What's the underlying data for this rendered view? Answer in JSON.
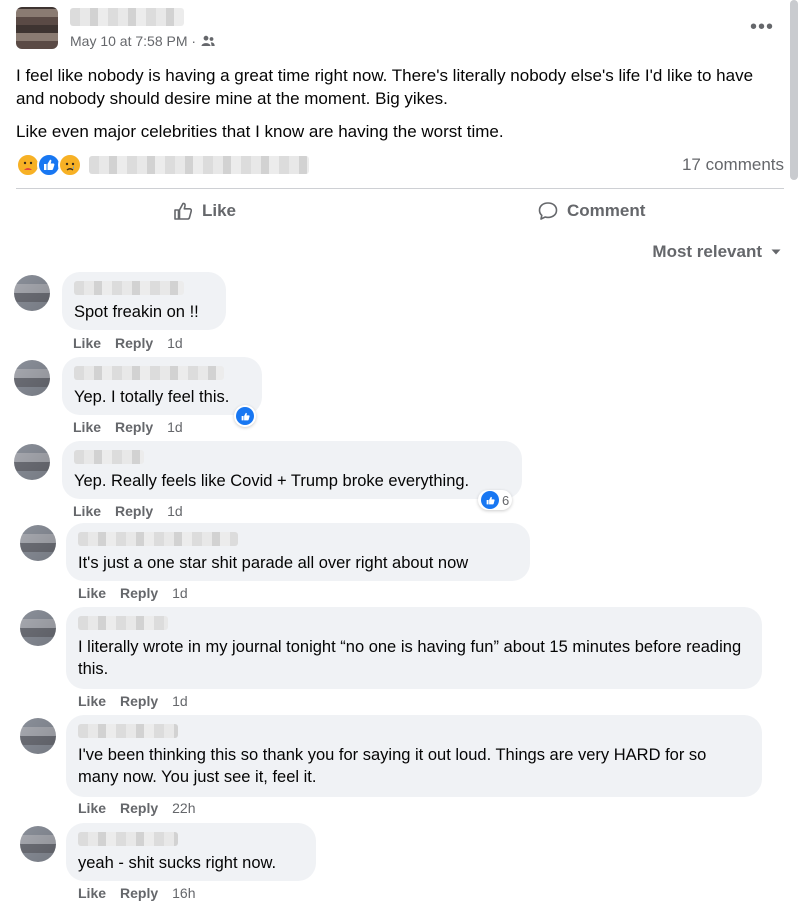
{
  "post": {
    "timestamp": "May 10 at 7:58 PM ·",
    "paragraphs": [
      "I feel like nobody is having a great time right now. There's literally nobody else's life I'd like to have and nobody should desire mine at the moment. Big yikes.",
      "Like even major celebrities that I know are having the worst time."
    ],
    "comments_count": "17 comments",
    "reaction_icons": [
      "care-reaction-icon",
      "like-reaction-icon",
      "sad-reaction-icon"
    ]
  },
  "actions": {
    "like": "Like",
    "comment": "Comment"
  },
  "sort": {
    "label": "Most relevant"
  },
  "colors": {
    "accent": "#1877f2",
    "bubble": "#f0f2f5",
    "muted": "#65676b"
  },
  "comments": [
    {
      "text": "Spot freakin on !!",
      "like": "Like",
      "reply": "Reply",
      "time": "1d"
    },
    {
      "text": "Yep. I totally feel this.",
      "like": "Like",
      "reply": "Reply",
      "time": "1d"
    },
    {
      "text": "Yep. Really feels like Covid + Trump broke everything.",
      "like": "Like",
      "reply": "Reply",
      "time": "1d",
      "reaction_count": "6"
    },
    {
      "text": "It's just a one star shit parade all over right about now",
      "like": "Like",
      "reply": "Reply",
      "time": "1d"
    },
    {
      "text": "I literally wrote in my journal tonight “no one is having fun” about 15 minutes before reading this.",
      "like": "Like",
      "reply": "Reply",
      "time": "1d"
    },
    {
      "text": "I've been thinking this so thank you for saying it out loud. Things are very HARD for so many now. You just see it, feel it.",
      "like": "Like",
      "reply": "Reply",
      "time": "22h"
    },
    {
      "text": "yeah - shit sucks right now.",
      "like": "Like",
      "reply": "Reply",
      "time": "16h"
    }
  ]
}
